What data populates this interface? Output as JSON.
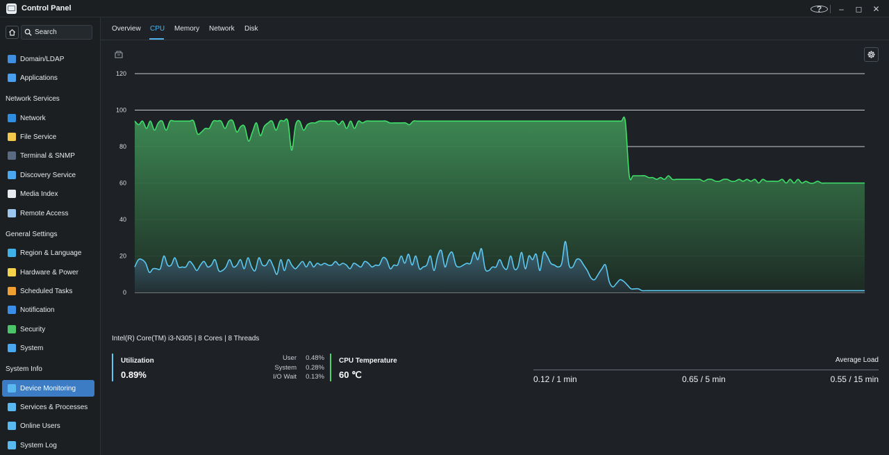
{
  "window": {
    "title": "Control Panel"
  },
  "sidebar": {
    "search_placeholder": "Search",
    "items": [
      {
        "label": "Domain/LDAP",
        "icon": "domain-icon",
        "color": "#3f8fe0"
      },
      {
        "label": "Applications",
        "icon": "applications-icon",
        "color": "#4a9ef0"
      },
      {
        "section": "Network Services"
      },
      {
        "label": "Network",
        "icon": "globe-icon",
        "color": "#2f8ee0"
      },
      {
        "label": "File Service",
        "icon": "folder-icon",
        "color": "#f3c84b"
      },
      {
        "label": "Terminal & SNMP",
        "icon": "terminal-icon",
        "color": "#5a6a80"
      },
      {
        "label": "Discovery Service",
        "icon": "magnifier-icon",
        "color": "#4aa8f0"
      },
      {
        "label": "Media Index",
        "icon": "media-index-icon",
        "color": "#e8ecf0"
      },
      {
        "label": "Remote Access",
        "icon": "cloud-icon",
        "color": "#9cc8f0"
      },
      {
        "section": "General Settings"
      },
      {
        "label": "Region & Language",
        "icon": "region-globe-icon",
        "color": "#3fb0e8"
      },
      {
        "label": "Hardware & Power",
        "icon": "lightbulb-icon",
        "color": "#f5d24a"
      },
      {
        "label": "Scheduled Tasks",
        "icon": "calendar-icon",
        "color": "#f0a030"
      },
      {
        "label": "Notification",
        "icon": "notification-icon",
        "color": "#3a8ee8"
      },
      {
        "label": "Security",
        "icon": "shield-icon",
        "color": "#4cc46a"
      },
      {
        "label": "System",
        "icon": "monitor-icon",
        "color": "#4aa8f0"
      },
      {
        "section": "System Info"
      },
      {
        "label": "Device Monitoring",
        "icon": "device-monitor-icon",
        "color": "#5ab8f0",
        "active": true
      },
      {
        "label": "Services & Processes",
        "icon": "services-icon",
        "color": "#5ab8f0"
      },
      {
        "label": "Online Users",
        "icon": "user-icon",
        "color": "#5ab8f0"
      },
      {
        "label": "System Log",
        "icon": "log-icon",
        "color": "#5ab8f0"
      }
    ]
  },
  "tabs": [
    {
      "label": "Overview"
    },
    {
      "label": "CPU",
      "active": true
    },
    {
      "label": "Memory"
    },
    {
      "label": "Network"
    },
    {
      "label": "Disk"
    }
  ],
  "chart_data": {
    "type": "area",
    "ylim": [
      0,
      120
    ],
    "yticks": [
      "0",
      "20",
      "40",
      "60",
      "80",
      "100",
      "120"
    ],
    "grid": true,
    "colors": {
      "temperature": "#3fe06a",
      "utilization": "#5cc9f2"
    },
    "series": [
      {
        "values": [
          94,
          92,
          94,
          90,
          94,
          89,
          93,
          94,
          89,
          94,
          94,
          94,
          94,
          94,
          94,
          94,
          87,
          88,
          90,
          90,
          94,
          94,
          94,
          90,
          94,
          94,
          88,
          91,
          91,
          83,
          88,
          93,
          86,
          91,
          93,
          94,
          89,
          94,
          94,
          94,
          78,
          92,
          94,
          89,
          92,
          93,
          93,
          94,
          94,
          94,
          94,
          94,
          92,
          94,
          90,
          94,
          90,
          94,
          93,
          94,
          94,
          94,
          94,
          94,
          94,
          93,
          93,
          93,
          93,
          93,
          92,
          94,
          94,
          94,
          94,
          94,
          94,
          94,
          94,
          94,
          94,
          94,
          94,
          94,
          94,
          94,
          94,
          94,
          94,
          94,
          94,
          94,
          94,
          94,
          94,
          94,
          94,
          94,
          94,
          94,
          94,
          94,
          94,
          94,
          94,
          94,
          94,
          94,
          94,
          94,
          94,
          94,
          94,
          94,
          94,
          94,
          94,
          94,
          94,
          94,
          94,
          94,
          94,
          94,
          94,
          94,
          64,
          64,
          64,
          64,
          64,
          63,
          63,
          62,
          63,
          62,
          64,
          62,
          62,
          62,
          62,
          62,
          62,
          62,
          62,
          61,
          62,
          62,
          61,
          61,
          62,
          62,
          61,
          61,
          62,
          61,
          62,
          61,
          62,
          60,
          62,
          61,
          61,
          61,
          61,
          62,
          60,
          62,
          60,
          62,
          60,
          61,
          60,
          60,
          61,
          60,
          60,
          60,
          60,
          60,
          60,
          60,
          60,
          60,
          60,
          60,
          60
        ]
      },
      {
        "values": [
          14,
          18,
          18,
          16,
          11,
          13,
          13,
          13,
          20,
          15,
          15,
          19,
          14,
          14,
          14,
          17,
          15,
          12,
          15,
          17,
          14,
          15,
          18,
          12,
          12,
          14,
          18,
          14,
          15,
          18,
          13,
          19,
          14,
          12,
          19,
          15,
          15,
          18,
          14,
          10,
          18,
          12,
          18,
          15,
          13,
          15,
          17,
          14,
          17,
          14,
          16,
          15,
          16,
          15,
          15,
          17,
          15,
          16,
          15,
          13,
          16,
          15,
          14,
          17,
          16,
          14,
          15,
          15,
          19,
          18,
          13,
          15,
          15,
          20,
          16,
          21,
          15,
          20,
          13,
          14,
          15,
          20,
          12,
          20,
          23,
          14,
          20,
          22,
          15,
          14,
          15,
          16,
          16,
          22,
          18,
          24,
          13,
          12,
          14,
          14,
          18,
          14,
          13,
          20,
          13,
          14,
          22,
          13,
          20,
          18,
          21,
          12,
          22,
          20,
          16,
          15,
          14,
          16,
          28,
          15,
          14,
          18,
          18,
          15,
          12,
          8,
          7,
          10,
          13,
          15,
          6,
          3,
          5,
          7,
          6,
          4,
          2,
          2,
          2,
          1,
          1,
          1,
          1,
          1,
          1,
          1,
          1,
          1,
          1,
          1,
          1,
          1,
          1,
          1,
          1,
          1,
          1,
          1,
          1,
          1,
          1,
          1,
          1,
          1,
          1,
          1,
          1,
          1,
          1,
          1,
          1,
          1,
          1,
          1,
          1,
          1,
          1,
          1,
          1,
          1,
          1,
          1,
          1,
          1,
          1,
          1,
          1,
          1,
          1,
          1,
          1,
          1,
          1,
          1,
          1,
          1,
          1,
          1,
          1,
          1,
          1
        ]
      }
    ]
  },
  "cpu": {
    "info": "Intel(R) Core(TM) i3-N305 | 8 Cores | 8 Threads",
    "utilization_title": "Utilization",
    "utilization_value": "0.89%",
    "breakdown": [
      {
        "label": "User",
        "value": "0.48%"
      },
      {
        "label": "System",
        "value": "0.28%"
      },
      {
        "label": "I/O Wait",
        "value": "0.13%"
      }
    ],
    "temperature_title": "CPU Temperature",
    "temperature_value": "60 ℃",
    "average_load_title": "Average Load",
    "loads": [
      "0.12 / 1 min",
      "0.65 / 5 min",
      "0.55 / 15 min"
    ]
  }
}
